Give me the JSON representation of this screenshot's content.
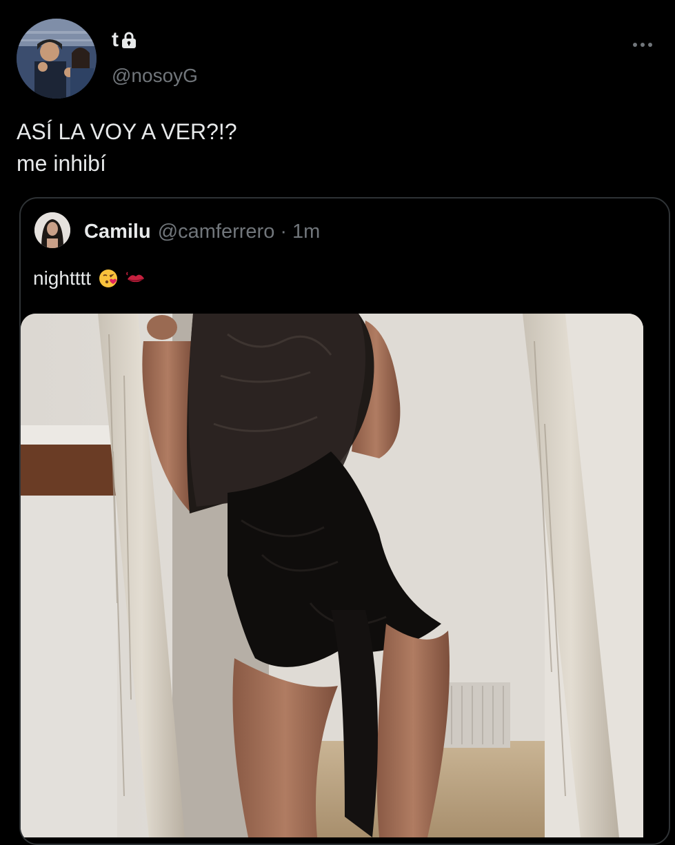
{
  "tweet": {
    "author": {
      "display_name": "t",
      "handle": "@nosoyG",
      "avatar": "profile-photo",
      "protected_icon": "lock-icon"
    },
    "more_icon": "more-dots-icon",
    "text_lines": [
      "ASÍ LA VOY A VER?!?",
      "me inhibí"
    ]
  },
  "quote": {
    "author": {
      "display_name": "Camilu",
      "handle": "@camferrero",
      "separator": "·",
      "time": "1m",
      "avatar": "profile-photo"
    },
    "text": "nightttt",
    "emojis": [
      "face-blowing-kiss-icon",
      "kiss-mark-icon"
    ],
    "media": "photo"
  },
  "colors": {
    "background": "#000000",
    "primary_text": "#e7e9ea",
    "secondary_text": "#71767b",
    "border": "#2f3336"
  }
}
